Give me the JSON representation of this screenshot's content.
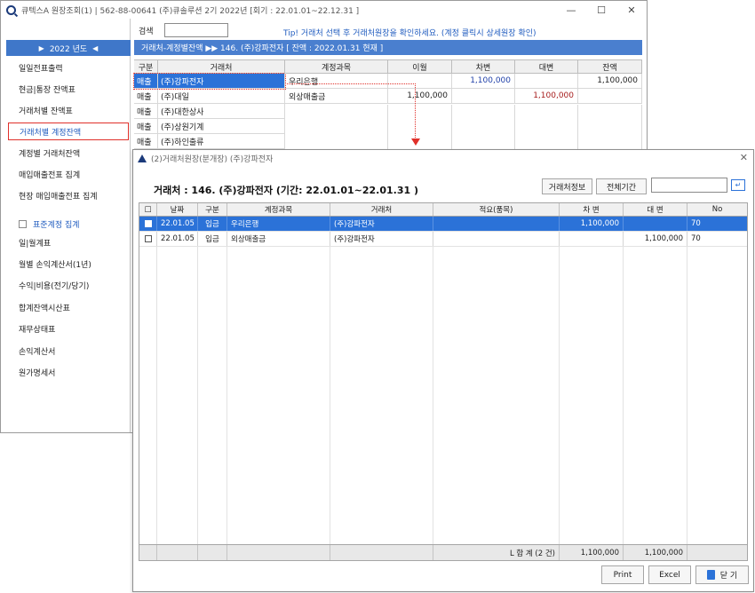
{
  "window": {
    "title": "큐텍스A 원장조회(1)  |  562-88-00641 (주)큐솔루션 2기 2022년 [회기 : 22.01.01~22.12.31 ]",
    "minimize": "—",
    "maximize": "☐",
    "close": "✕"
  },
  "sidebar": {
    "year_label": "2022 년도",
    "year_prev": "▶",
    "year_next": "◀",
    "items": [
      {
        "label": "일일전표출력"
      },
      {
        "label": "현금|통장 잔액표"
      },
      {
        "label": "거래처별 잔액표"
      },
      {
        "label": "거래처별 계정잔액"
      },
      {
        "label": "계정별 거래처잔액"
      },
      {
        "label": "매입매출전표 집계"
      },
      {
        "label": "현장 매입매출전표 집계"
      }
    ],
    "standard_check_label": "표준계정 집계",
    "items2": [
      {
        "label": "일|월계표"
      },
      {
        "label": "월별 손익계산서(1년)"
      },
      {
        "label": "수익|비용(전기/당기)"
      },
      {
        "label": "합계잔액시산표"
      },
      {
        "label": "재무상태표"
      },
      {
        "label": "손익계산서"
      },
      {
        "label": "원가명세서"
      }
    ]
  },
  "search": {
    "label": "검색",
    "value": ""
  },
  "tip": "Tip! 거래처 선택 후 거래처원장을 확인하세요. (계정 클릭시 상세원장 확인)",
  "header_bar": "거래처-계정별잔액 ▶▶ 146. (주)강파전자  [ 잔액 : 2022.01.31 현재 ]",
  "customers": {
    "headers": [
      "구분",
      "거래처"
    ],
    "rows": [
      {
        "type": "매출",
        "name": "(주)강파전자"
      },
      {
        "type": "매출",
        "name": "(주)대일"
      },
      {
        "type": "매출",
        "name": "(주)대한상사"
      },
      {
        "type": "매출",
        "name": "(주)상원기계"
      },
      {
        "type": "매출",
        "name": "(주)하인출류"
      }
    ]
  },
  "accounts": {
    "headers": [
      "계정과목",
      "이월",
      "차변",
      "대변",
      "잔액"
    ],
    "rows": [
      {
        "account": "우리은행",
        "carry": "",
        "debit": "1,100,000",
        "credit": "",
        "balance": "1,100,000"
      },
      {
        "account": "외상매출금",
        "carry": "1,100,000",
        "debit": "",
        "credit": "1,100,000",
        "balance": ""
      }
    ]
  },
  "popup": {
    "title": "(2)거래처원장(분개장)  (주)강파전자",
    "close": "✕",
    "heading": "거래처 : 146. (주)강파전자   (기간: 22.01.01~22.01.31 )",
    "btn_info": "거래처정보",
    "btn_period": "전체기간",
    "search_value": "",
    "go_label": "↵",
    "headers": [
      "□",
      "날짜",
      "구분",
      "계정과목",
      "거래처",
      "적요(품목)",
      "차 변",
      "대 변",
      "No"
    ],
    "rows": [
      {
        "date": "22.01.05",
        "type": "입금",
        "account": "우리은행",
        "customer": "(주)강파전자",
        "memo": "",
        "debit": "1,100,000",
        "credit": "",
        "no": "70"
      },
      {
        "date": "22.01.05",
        "type": "입금",
        "account": "외상매출금",
        "customer": "(주)강파전자",
        "memo": "",
        "debit": "",
        "credit": "1,100,000",
        "no": "70"
      }
    ],
    "footer": {
      "label": "L 합  계 (2 건)",
      "debit": "1,100,000",
      "credit": "1,100,000"
    },
    "btn_print": "Print",
    "btn_excel": "Excel",
    "btn_close": "닫 기"
  }
}
